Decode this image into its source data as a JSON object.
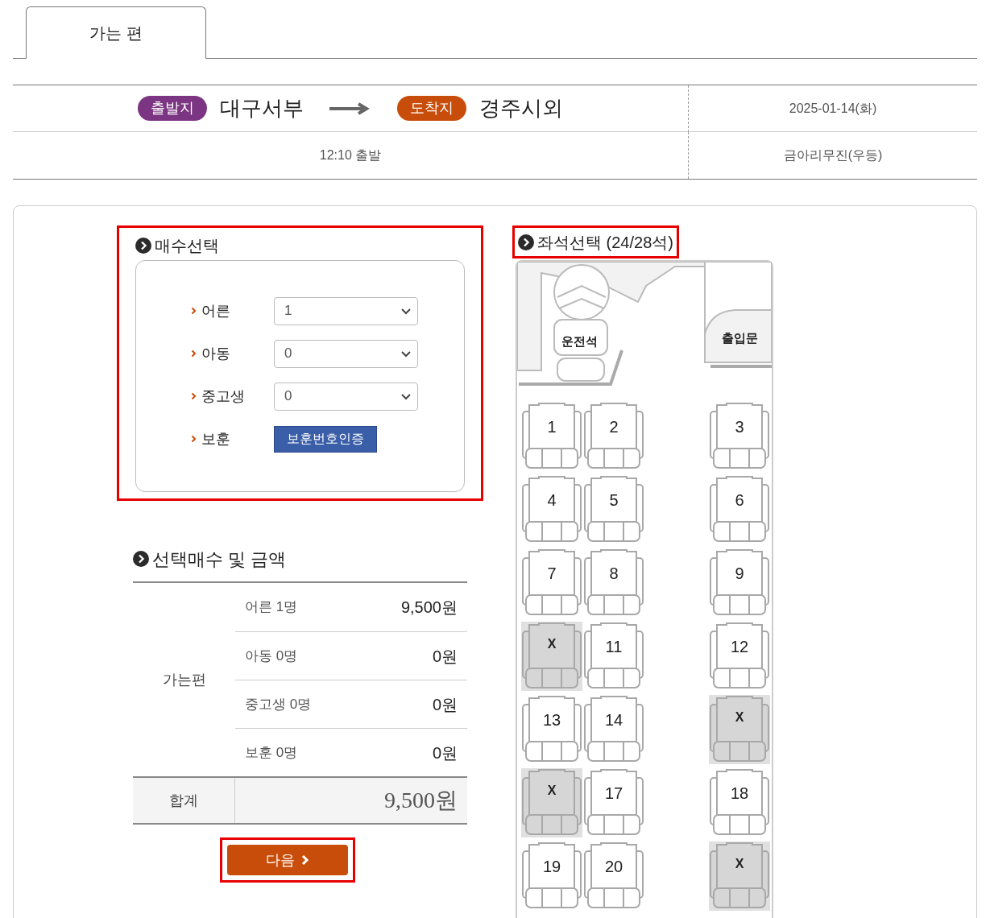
{
  "tabs": [
    {
      "label": "가는 편",
      "selected": true
    }
  ],
  "route": {
    "departure_badge": "출발지",
    "departure": "대구서부",
    "arrival_badge": "도착지",
    "arrival": "경주시외",
    "date": "2025-01-14(화)",
    "time": "12:10 출발",
    "company": "금아리무진(우등)"
  },
  "ticket_selection": {
    "title": "매수선택",
    "rows": [
      {
        "label": "어른",
        "kind": "select",
        "value": "1"
      },
      {
        "label": "아동",
        "kind": "select",
        "value": "0"
      },
      {
        "label": "중고생",
        "kind": "select",
        "value": "0"
      },
      {
        "label": "보훈",
        "kind": "button",
        "button": "보훈번호인증"
      }
    ]
  },
  "summary": {
    "title": "선택매수 및 금액",
    "group": "가는편",
    "rows": [
      {
        "label": "어른 1명",
        "amount": "9,500원"
      },
      {
        "label": "아동 0명",
        "amount": "0원"
      },
      {
        "label": "중고생 0명",
        "amount": "0원"
      },
      {
        "label": "보훈 0명",
        "amount": "0원"
      }
    ],
    "total_label": "합계",
    "total": "9,500원"
  },
  "next_button": "다음",
  "seat_map": {
    "title": "좌석선택 (24/28석)",
    "driver": "운전석",
    "door": "출입문",
    "rows": [
      [
        {
          "label": "1",
          "taken": false
        },
        {
          "label": "2",
          "taken": false
        },
        {
          "label": "3",
          "taken": false
        }
      ],
      [
        {
          "label": "4",
          "taken": false
        },
        {
          "label": "5",
          "taken": false
        },
        {
          "label": "6",
          "taken": false
        }
      ],
      [
        {
          "label": "7",
          "taken": false
        },
        {
          "label": "8",
          "taken": false
        },
        {
          "label": "9",
          "taken": false
        }
      ],
      [
        {
          "label": "X",
          "taken": true
        },
        {
          "label": "11",
          "taken": false
        },
        {
          "label": "12",
          "taken": false
        }
      ],
      [
        {
          "label": "13",
          "taken": false
        },
        {
          "label": "14",
          "taken": false
        },
        {
          "label": "X",
          "taken": true
        }
      ],
      [
        {
          "label": "X",
          "taken": true
        },
        {
          "label": "17",
          "taken": false
        },
        {
          "label": "18",
          "taken": false
        }
      ],
      [
        {
          "label": "19",
          "taken": false
        },
        {
          "label": "20",
          "taken": false
        },
        {
          "label": "X",
          "taken": true
        }
      ]
    ]
  }
}
